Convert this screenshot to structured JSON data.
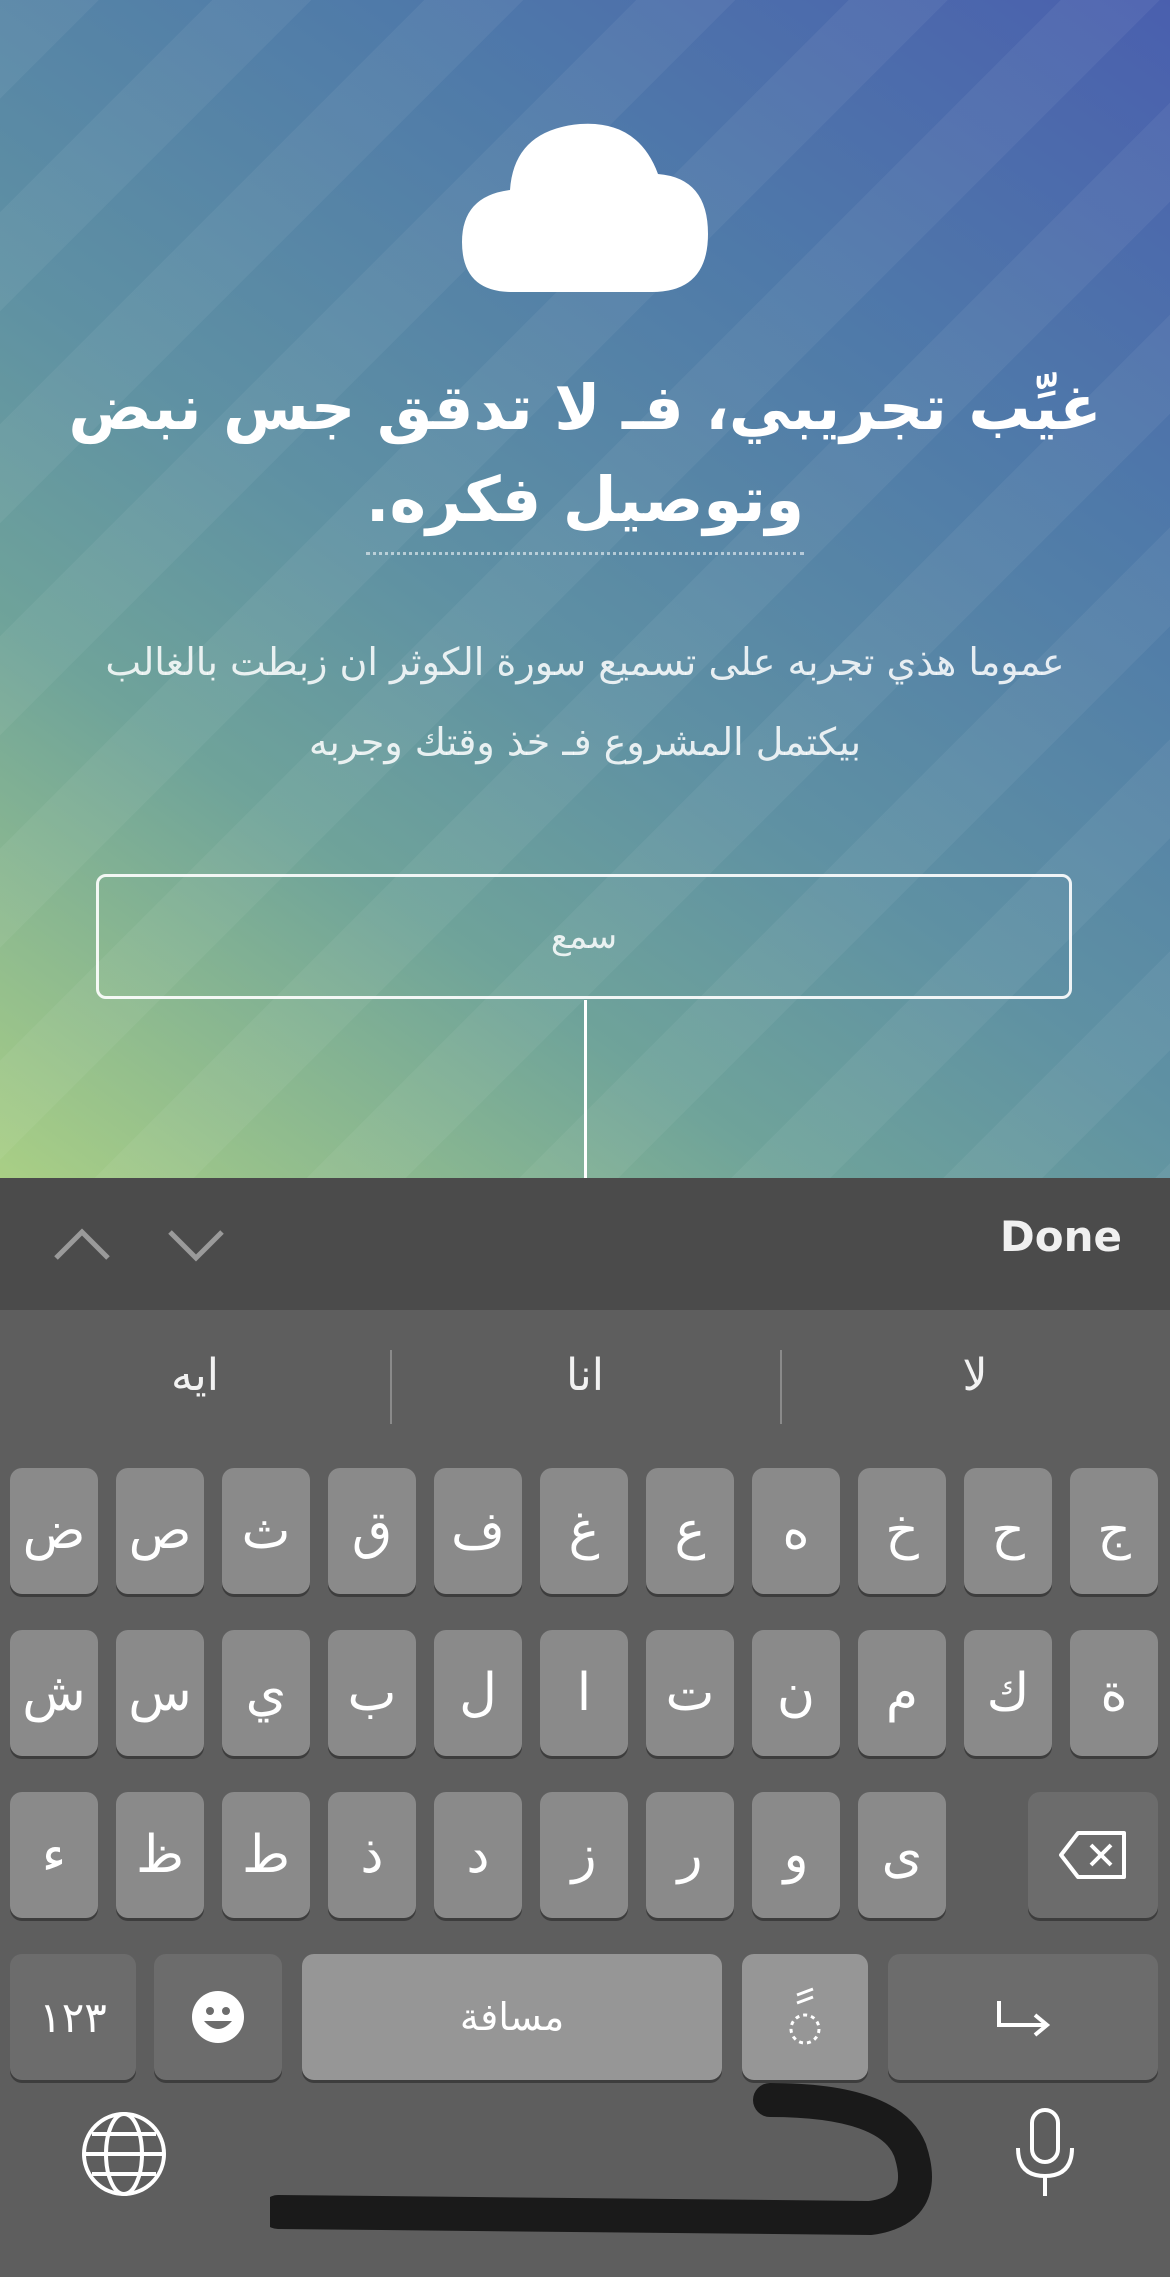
{
  "hero": {
    "title_line1": "غيِّب تجريبي، فـ لا تدقق جس نبض",
    "title_line2": "وتوصيل فكره.",
    "subtitle_line1": "عموما هذي تجربه على تسميع سورة الكوثر ان زبطت بالغالب",
    "subtitle_line2": "بيكتمل المشروع فـ خذ وقتك وجربه",
    "input_placeholder": "سمع"
  },
  "toolbar": {
    "done_label": "Done",
    "prev_icon": "chevron-up-icon",
    "next_icon": "chevron-down-icon"
  },
  "suggestions": [
    "ايه",
    "انا",
    "لا"
  ],
  "keyboard": {
    "row1": [
      "ض",
      "ص",
      "ث",
      "ق",
      "ف",
      "غ",
      "ع",
      "ه",
      "خ",
      "ح",
      "ج"
    ],
    "row2": [
      "ش",
      "س",
      "ي",
      "ب",
      "ل",
      "ا",
      "ت",
      "ن",
      "م",
      "ك",
      "ة"
    ],
    "row3": [
      "ء",
      "ظ",
      "ط",
      "ذ",
      "د",
      "ز",
      "ر",
      "و",
      "ى"
    ],
    "numbers_label": "١٢٣",
    "space_label": "مسافة",
    "diacritic_label": "ًٍ",
    "icons": [
      "emoji-icon",
      "backspace-icon",
      "return-icon",
      "globe-icon",
      "microphone-icon"
    ]
  }
}
